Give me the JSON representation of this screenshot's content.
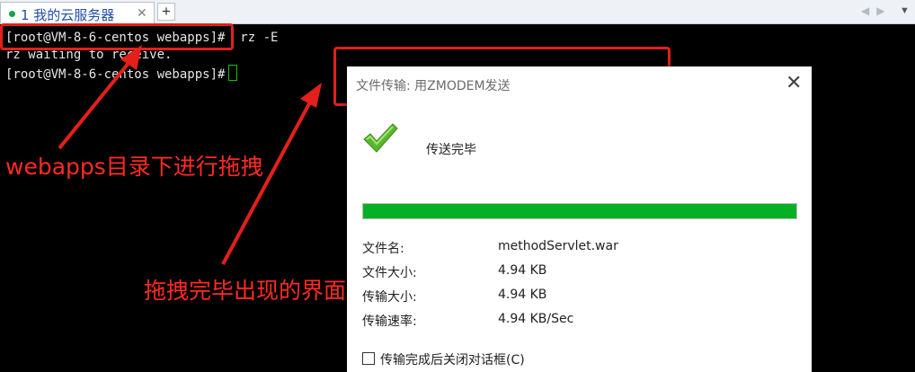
{
  "tabbar": {
    "tab_label": "1 我的云服务器",
    "tab_close": "✕",
    "new_tab": "+",
    "nav_arrows": "◀▶",
    "menu": "▼"
  },
  "terminal": {
    "lines": [
      "[root@VM-8-6-centos webapps]#  rz -E",
      "rz waiting to receive.",
      "[root@VM-8-6-centos webapps]#"
    ]
  },
  "annotations": {
    "first": "webapps目录下进行拖拽",
    "second": "拖拽完毕出现的界面",
    "color": "#e3201b"
  },
  "dialog": {
    "title": "文件传输: 用ZMODEM发送",
    "close": "✕",
    "status": "传送完毕",
    "progress": 1.0,
    "progress_color": "#06b025",
    "rows": [
      {
        "label": "文件名:",
        "value": "methodServlet.war"
      },
      {
        "label": "文件大小:",
        "value": "4.94 KB"
      },
      {
        "label": "传输大小:",
        "value": "4.94 KB"
      },
      {
        "label": "传输速率:",
        "value": "4.94 KB/Sec"
      }
    ],
    "close_after_label": "传输完成后关闭对话框(C)"
  }
}
